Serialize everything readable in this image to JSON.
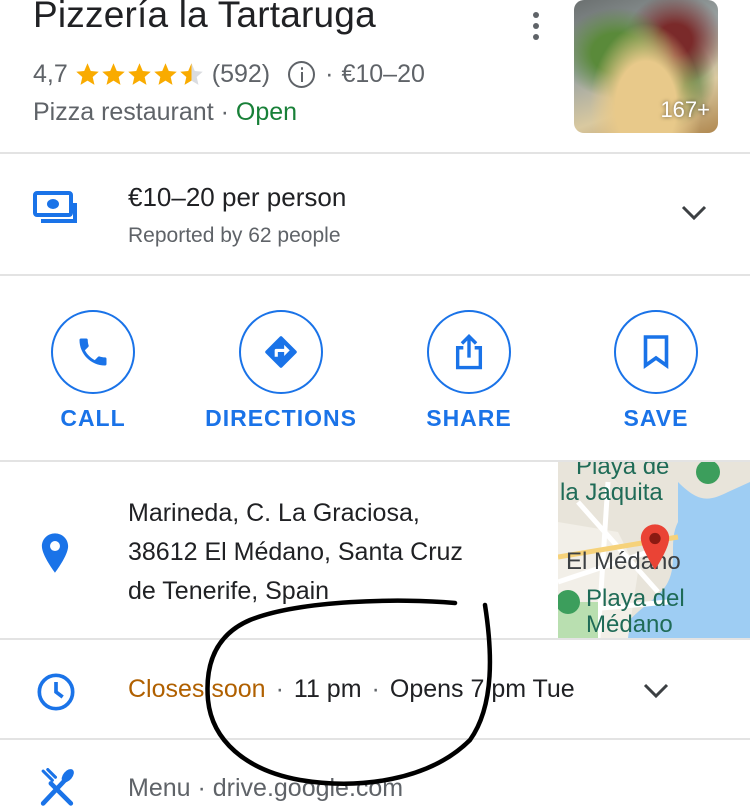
{
  "place": {
    "title": "Pizzería la Tartaruga",
    "rating": "4,7",
    "stars": 4.5,
    "review_count": "(592)",
    "price_range": "€10–20",
    "category": "Pizza restaurant",
    "status": "Open",
    "photo_count": "167+"
  },
  "price": {
    "main": "€10–20 per person",
    "sub": "Reported by 62 people"
  },
  "actions": [
    {
      "label": "CALL",
      "icon": "phone-icon"
    },
    {
      "label": "DIRECTIONS",
      "icon": "directions-icon"
    },
    {
      "label": "SHARE",
      "icon": "share-icon"
    },
    {
      "label": "SAVE",
      "icon": "bookmark-icon"
    }
  ],
  "address": {
    "line1": "Marineda, C. La Graciosa,",
    "line2": "38612 El Médano, Santa Cruz",
    "line3": "de Tenerife, Spain"
  },
  "map": {
    "label1": "Playa de",
    "label1b": "la Jaquita",
    "label2": "El Médano",
    "label3": "Playa del",
    "label3b": "Médano"
  },
  "hours": {
    "status": "Closes soon",
    "close_time": "11 pm",
    "next": "Opens 7 pm Tue"
  },
  "menu": {
    "text": "Menu · drive.google.com"
  },
  "colors": {
    "accent": "#1a73e8",
    "open": "#188038",
    "closes_soon": "#b06000",
    "star": "#f9ab00"
  }
}
